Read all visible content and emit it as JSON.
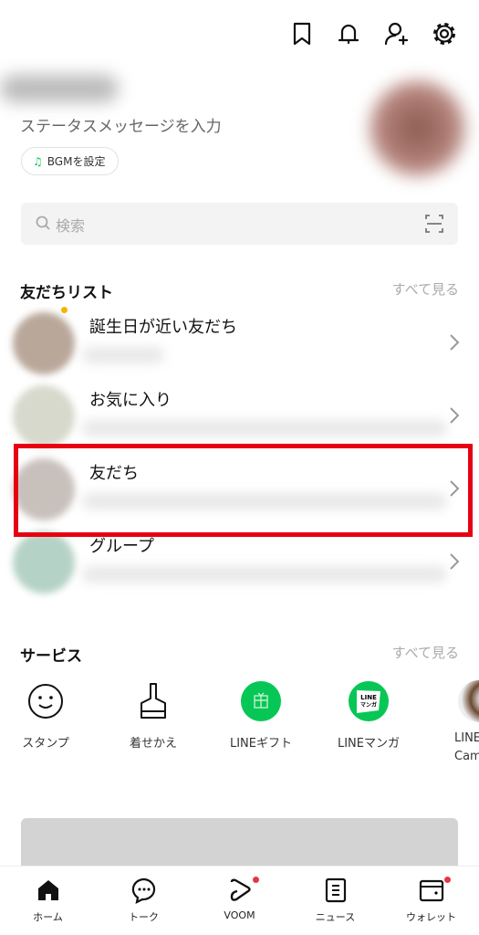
{
  "header": {
    "icons": [
      "bookmark-icon",
      "bell-icon",
      "add-friend-icon",
      "gear-icon"
    ]
  },
  "profile": {
    "status_placeholder": "ステータスメッセージを入力",
    "bgm_label": "BGMを設定"
  },
  "search": {
    "placeholder": "検索"
  },
  "friends": {
    "title": "友だちリスト",
    "see_all": "すべて見る",
    "rows": [
      {
        "label": "誕生日が近い友だち"
      },
      {
        "label": "お気に入り"
      },
      {
        "label": "友だち",
        "highlighted": true
      },
      {
        "label": "グループ"
      }
    ]
  },
  "services": {
    "title": "サービス",
    "see_all": "すべて見る",
    "items": [
      {
        "label": "スタンプ",
        "icon": "smile-icon"
      },
      {
        "label": "着せかえ",
        "icon": "brush-icon"
      },
      {
        "label": "LINEギフト",
        "icon": "gift-icon"
      },
      {
        "label": "LINEマンガ",
        "icon": "manga-icon",
        "icon_text": "LINE マンガ"
      },
      {
        "label": "LINE Camera",
        "icon": "camera-icon"
      }
    ]
  },
  "bottom_nav": [
    {
      "label": "ホーム",
      "active": true
    },
    {
      "label": "トーク"
    },
    {
      "label": "VOOM",
      "badge": true
    },
    {
      "label": "ニュース"
    },
    {
      "label": "ウォレット",
      "badge": true
    }
  ],
  "colors": {
    "accent": "#06c755",
    "highlight": "#e60012",
    "badge": "#e8334a"
  }
}
